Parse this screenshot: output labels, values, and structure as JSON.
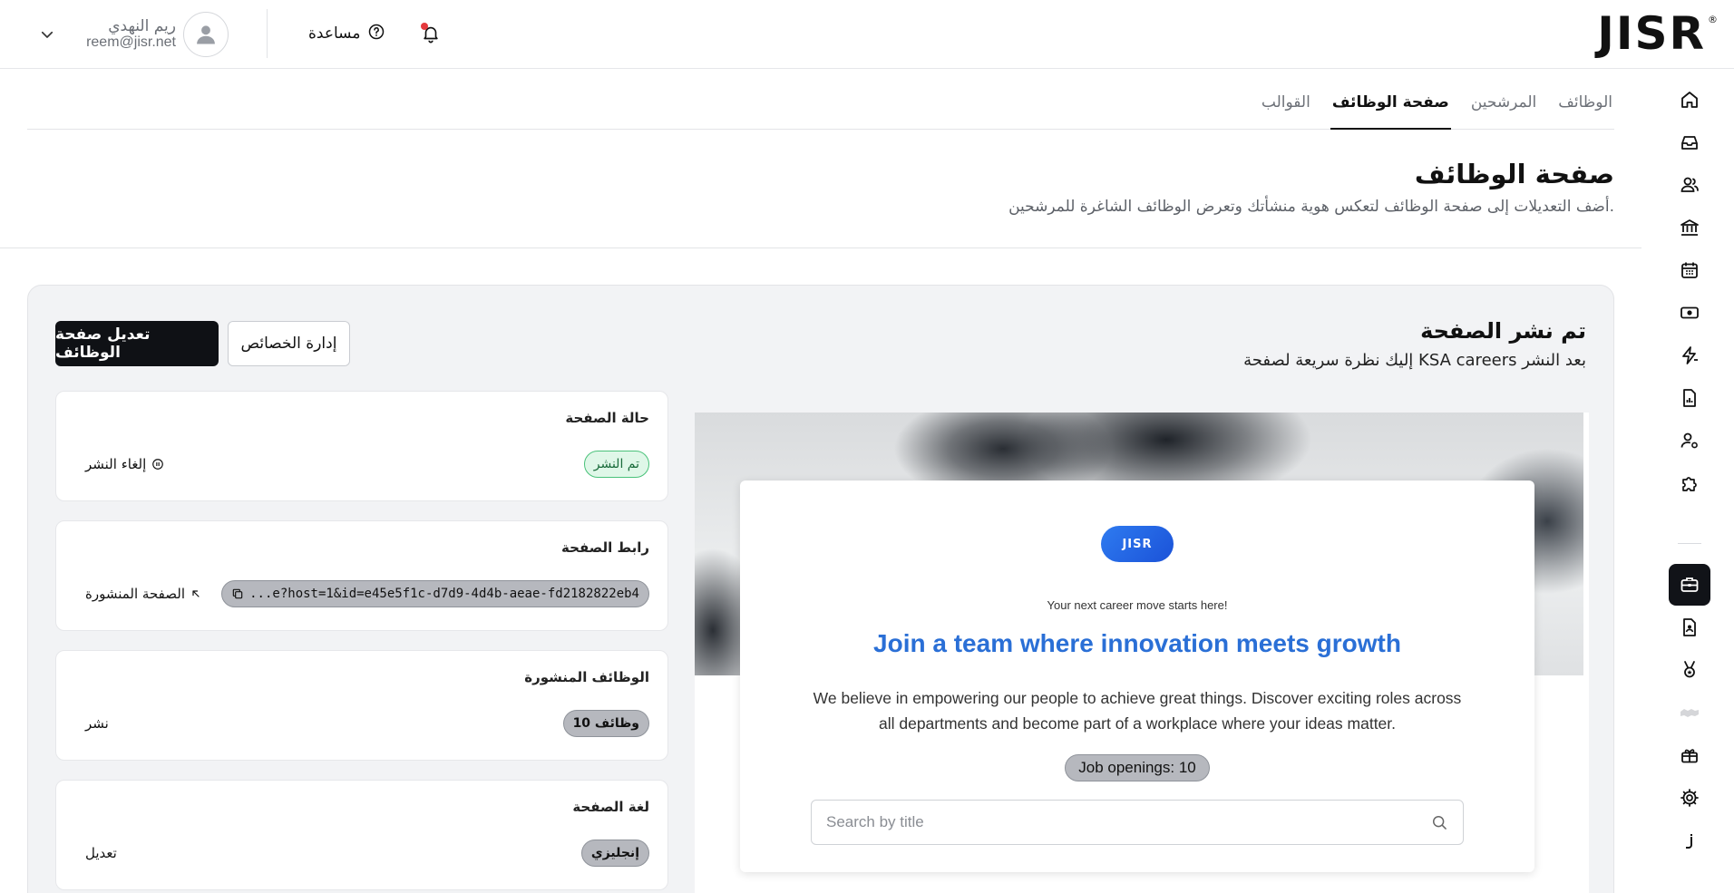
{
  "brand": {
    "wordmark": "JISR",
    "reg": "®"
  },
  "user": {
    "name": "ريم النهدي",
    "email": "reem@jisr.net"
  },
  "header": {
    "help_label": "مساعدة"
  },
  "tabs": [
    {
      "label": "الوظائف",
      "active": false
    },
    {
      "label": "المرشحين",
      "active": false
    },
    {
      "label": "صفحة الوظائف",
      "active": true
    },
    {
      "label": "القوالب",
      "active": false
    }
  ],
  "page": {
    "title": "صفحة الوظائف",
    "subtitle": "أضف التعديلات إلى صفحة الوظائف لتعكس هوية منشأتك وتعرض الوظائف الشاغرة للمرشحين."
  },
  "publish": {
    "title": "تم نشر الصفحة",
    "subtitle": "إليك نظرة سريعة لصفحة KSA careers بعد النشر",
    "edit_button": "تعديل صفحة الوظائف",
    "properties_button": "إدارة الخصائص"
  },
  "cards": {
    "status": {
      "title": "حالة الصفحة",
      "badge": "تم النشر",
      "action": "إلغاء النشر"
    },
    "link": {
      "title": "رابط الصفحة",
      "url": "...e?host=1&id=e45e5f1c-d7d9-4d4b-aeae-fd2182822eb4",
      "action": "الصفحة المنشورة"
    },
    "jobs": {
      "title": "الوظائف المنشورة",
      "badge": "10 وظائف",
      "action": "نشر"
    },
    "language": {
      "title": "لغة الصفحة",
      "badge": "إنجليزي",
      "action": "تعديل"
    }
  },
  "preview": {
    "logo": "JISR",
    "tagline": "Your next career move starts here!",
    "headline": "Join a team where innovation meets growth",
    "description": "We believe in empowering our people to achieve great things. Discover exciting roles across all departments and become part of a workplace where your ideas matter.",
    "job_openings": "Job openings: 10",
    "search_placeholder": "Search by title"
  },
  "colors": {
    "accent_blue": "#2a6fd6",
    "dark": "#0f1115",
    "published_green": "#4ac27a",
    "notification": "#e5393d"
  },
  "rail_icons": [
    "home-icon",
    "inbox-icon",
    "people-icon",
    "bank-icon",
    "calendar-icon",
    "money-icon",
    "bolt-icon",
    "report-icon",
    "user-settings-icon",
    "puzzle-icon",
    "briefcase-icon",
    "document-user-icon",
    "medal-icon",
    "handshake-icon",
    "gift-icon",
    "gear-icon",
    "jisr-mini-icon"
  ]
}
